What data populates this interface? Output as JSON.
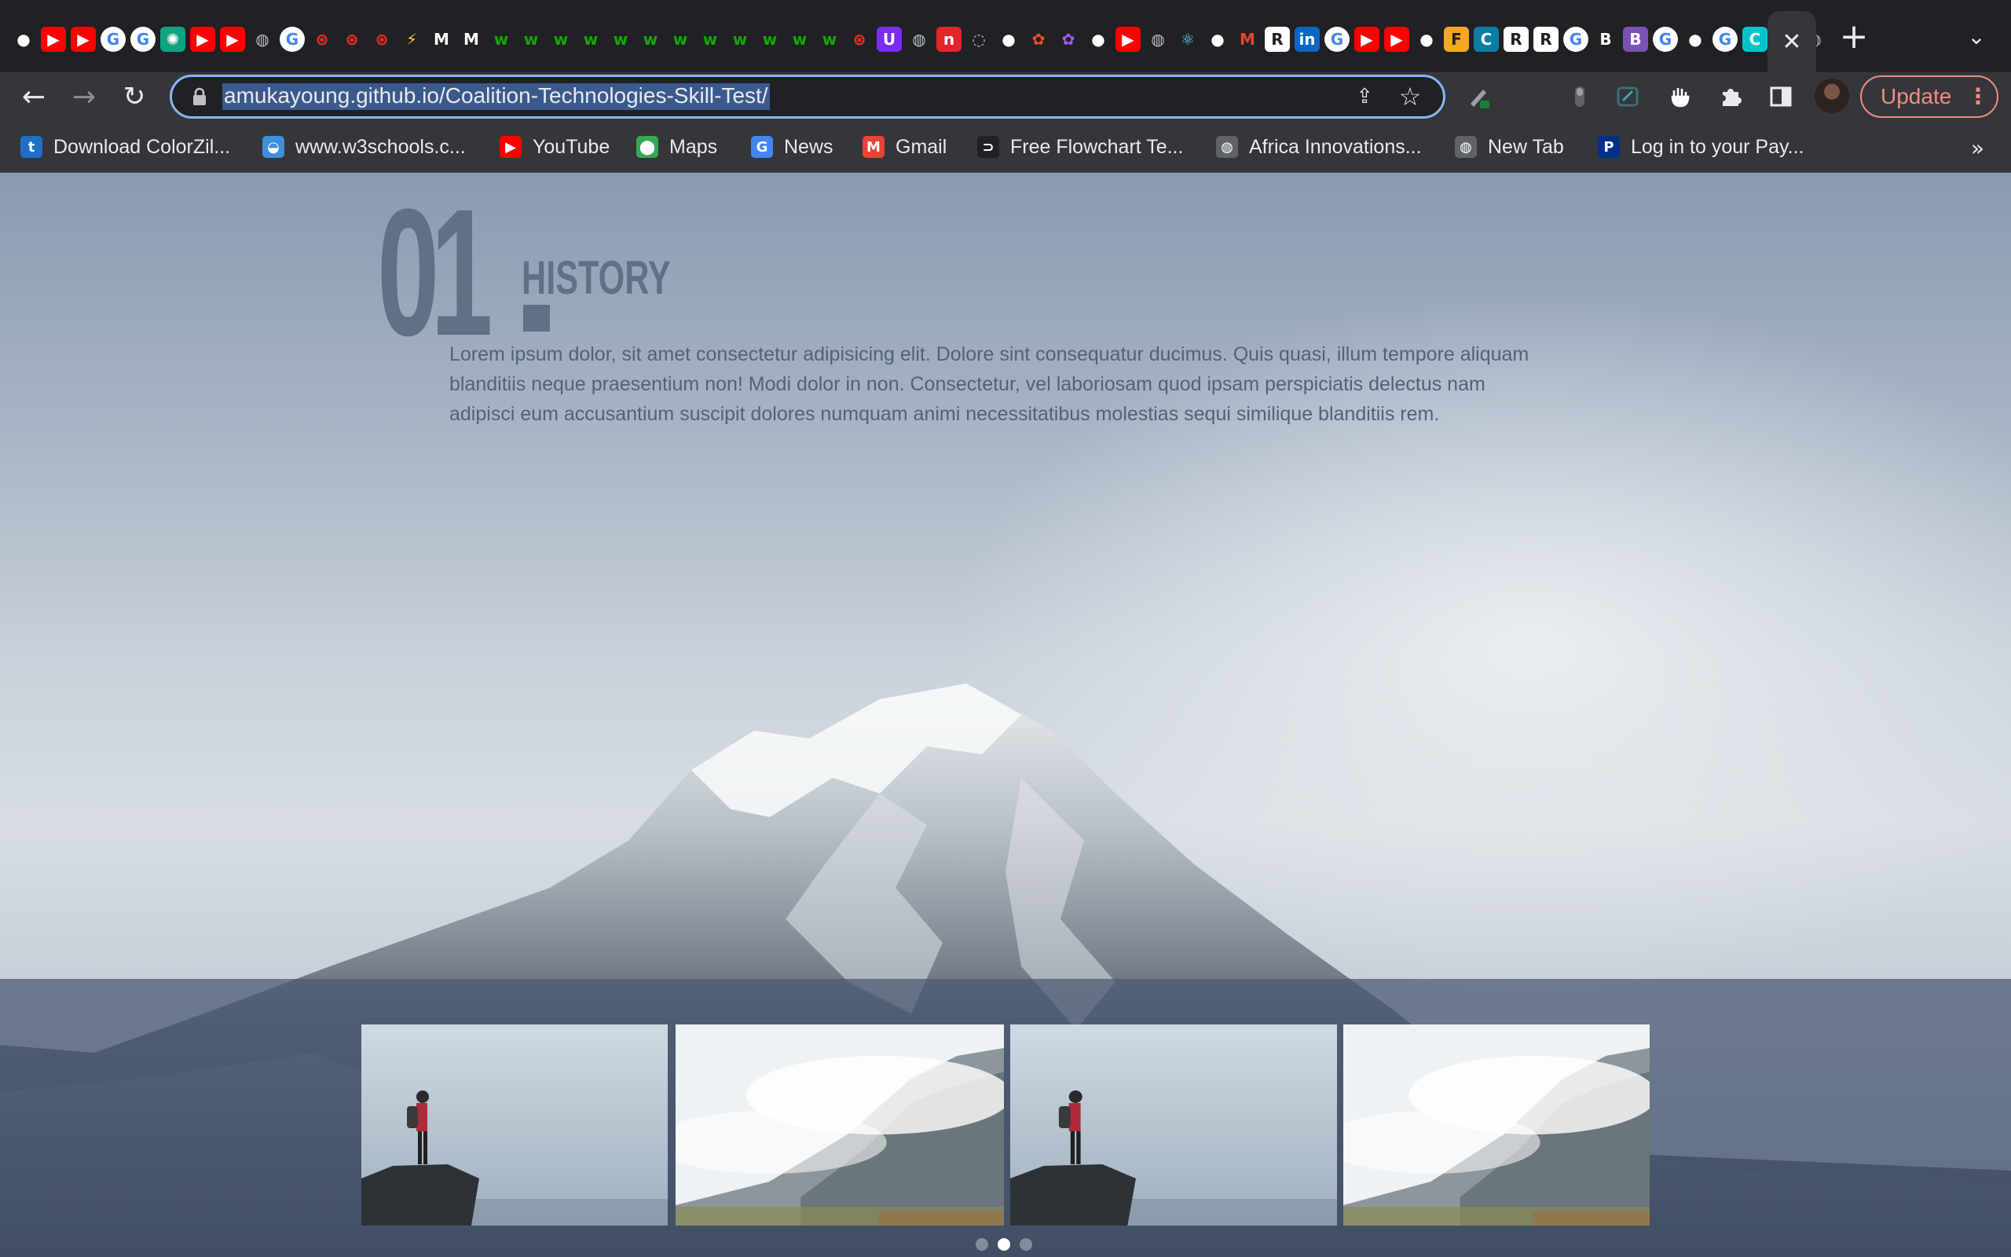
{
  "browser": {
    "tab_favicons": [
      {
        "icon": "github-icon",
        "glyph": "●",
        "color": "#ffffff",
        "bg": "#202124"
      },
      {
        "icon": "youtube-icon",
        "glyph": "▶",
        "color": "#ffffff",
        "bg": "#ff0000"
      },
      {
        "icon": "youtube-icon",
        "glyph": "▶",
        "color": "#ffffff",
        "bg": "#ff0000"
      },
      {
        "icon": "google-icon",
        "glyph": "G",
        "color": "#4285f4",
        "bg": "#ffffff"
      },
      {
        "icon": "google-icon",
        "glyph": "G",
        "color": "#4285f4",
        "bg": "#ffffff"
      },
      {
        "icon": "chatgpt-icon",
        "glyph": "✺",
        "color": "#ffffff",
        "bg": "#10a37f"
      },
      {
        "icon": "youtube-icon",
        "glyph": "▶",
        "color": "#ffffff",
        "bg": "#ff0000"
      },
      {
        "icon": "youtube-icon",
        "glyph": "▶",
        "color": "#ffffff",
        "bg": "#ff0000"
      },
      {
        "icon": "globe-icon",
        "glyph": "◍",
        "color": "#bdc1c6",
        "bg": "#202124"
      },
      {
        "icon": "google-icon",
        "glyph": "G",
        "color": "#4285f4",
        "bg": "#ffffff"
      },
      {
        "icon": "laravel-icon",
        "glyph": "⊛",
        "color": "#ff2d20",
        "bg": "#202124"
      },
      {
        "icon": "laravel-icon",
        "glyph": "⊛",
        "color": "#ff2d20",
        "bg": "#202124"
      },
      {
        "icon": "laravel-icon",
        "glyph": "⊛",
        "color": "#ff2d20",
        "bg": "#202124"
      },
      {
        "icon": "vite-icon",
        "glyph": "⚡",
        "color": "#ffd028",
        "bg": "#202124"
      },
      {
        "icon": "medium-icon",
        "glyph": "M",
        "color": "#ffffff",
        "bg": "#202124"
      },
      {
        "icon": "medium-icon",
        "glyph": "M",
        "color": "#ffffff",
        "bg": "#202124"
      },
      {
        "icon": "upwork-icon",
        "glyph": "w",
        "color": "#14a800",
        "bg": "#202124"
      },
      {
        "icon": "upwork-icon",
        "glyph": "w",
        "color": "#14a800",
        "bg": "#202124"
      },
      {
        "icon": "upwork-icon",
        "glyph": "w",
        "color": "#14a800",
        "bg": "#202124"
      },
      {
        "icon": "upwork-icon",
        "glyph": "w",
        "color": "#14a800",
        "bg": "#202124"
      },
      {
        "icon": "upwork-icon",
        "glyph": "w",
        "color": "#14a800",
        "bg": "#202124"
      },
      {
        "icon": "upwork-icon",
        "glyph": "w",
        "color": "#14a800",
        "bg": "#202124"
      },
      {
        "icon": "upwork-icon",
        "glyph": "w",
        "color": "#14a800",
        "bg": "#202124"
      },
      {
        "icon": "upwork-icon",
        "glyph": "w",
        "color": "#14a800",
        "bg": "#202124"
      },
      {
        "icon": "upwork-icon",
        "glyph": "w",
        "color": "#14a800",
        "bg": "#202124"
      },
      {
        "icon": "upwork-icon",
        "glyph": "w",
        "color": "#14a800",
        "bg": "#202124"
      },
      {
        "icon": "upwork-icon",
        "glyph": "w",
        "color": "#14a800",
        "bg": "#202124"
      },
      {
        "icon": "upwork-icon",
        "glyph": "w",
        "color": "#14a800",
        "bg": "#202124"
      },
      {
        "icon": "laravel-icon",
        "glyph": "⊛",
        "color": "#ff2d20",
        "bg": "#202124"
      },
      {
        "icon": "shield-icon",
        "glyph": "U",
        "color": "#ffffff",
        "bg": "#7b2cf5"
      },
      {
        "icon": "globe-icon",
        "glyph": "◍",
        "color": "#bdc1c6",
        "bg": "#202124"
      },
      {
        "icon": "n-icon",
        "glyph": "n",
        "color": "#ffffff",
        "bg": "#e0262b"
      },
      {
        "icon": "loading-icon",
        "glyph": "◌",
        "color": "#bdc1c6",
        "bg": "#202124"
      },
      {
        "icon": "github-icon",
        "glyph": "●",
        "color": "#ffffff",
        "bg": "#202124"
      },
      {
        "icon": "figma-icon",
        "glyph": "✿",
        "color": "#f24e1e",
        "bg": "#202124"
      },
      {
        "icon": "figma-icon",
        "glyph": "✿",
        "color": "#a259ff",
        "bg": "#202124"
      },
      {
        "icon": "github-icon",
        "glyph": "●",
        "color": "#ffffff",
        "bg": "#202124"
      },
      {
        "icon": "youtube-icon",
        "glyph": "▶",
        "color": "#ffffff",
        "bg": "#ff0000"
      },
      {
        "icon": "globe-icon",
        "glyph": "◍",
        "color": "#bdc1c6",
        "bg": "#202124"
      },
      {
        "icon": "react-icon",
        "glyph": "⚛",
        "color": "#61dafb",
        "bg": "#202124"
      },
      {
        "icon": "github-icon",
        "glyph": "●",
        "color": "#ffffff",
        "bg": "#202124"
      },
      {
        "icon": "gmail-icon",
        "glyph": "M",
        "color": "#ea4335",
        "bg": "#202124"
      },
      {
        "icon": "r-icon",
        "glyph": "R",
        "color": "#202124",
        "bg": "#ffffff"
      },
      {
        "icon": "linkedin-icon",
        "glyph": "in",
        "color": "#ffffff",
        "bg": "#0a66c2"
      },
      {
        "icon": "google-icon",
        "glyph": "G",
        "color": "#4285f4",
        "bg": "#ffffff"
      },
      {
        "icon": "youtube-icon",
        "glyph": "▶",
        "color": "#ffffff",
        "bg": "#ff0000"
      },
      {
        "icon": "youtube-icon",
        "glyph": "▶",
        "color": "#ffffff",
        "bg": "#ff0000"
      },
      {
        "icon": "github-icon",
        "glyph": "●",
        "color": "#ffffff",
        "bg": "#202124"
      },
      {
        "icon": "f-icon",
        "glyph": "F",
        "color": "#202124",
        "bg": "#f5a623"
      },
      {
        "icon": "c-icon",
        "glyph": "C",
        "color": "#ffffff",
        "bg": "#0a7ea4"
      },
      {
        "icon": "r-icon",
        "glyph": "R",
        "color": "#202124",
        "bg": "#ffffff"
      },
      {
        "icon": "r-icon",
        "glyph": "R",
        "color": "#202124",
        "bg": "#ffffff"
      },
      {
        "icon": "google-icon",
        "glyph": "G",
        "color": "#4285f4",
        "bg": "#ffffff"
      },
      {
        "icon": "b-icon",
        "glyph": "B",
        "color": "#ffffff",
        "bg": "#202124"
      },
      {
        "icon": "bootstrap-icon",
        "glyph": "B",
        "color": "#ffffff",
        "bg": "#7952b3"
      },
      {
        "icon": "google-icon",
        "glyph": "G",
        "color": "#4285f4",
        "bg": "#ffffff"
      },
      {
        "icon": "github-icon",
        "glyph": "●",
        "color": "#ffffff",
        "bg": "#202124"
      },
      {
        "icon": "google-icon",
        "glyph": "G",
        "color": "#4285f4",
        "bg": "#ffffff"
      },
      {
        "icon": "canva-icon",
        "glyph": "C",
        "color": "#ffffff",
        "bg": "#00c4cc"
      },
      {
        "icon": "github-icon",
        "glyph": "●",
        "color": "#ffffff",
        "bg": "#202124"
      },
      {
        "icon": "globe-icon",
        "glyph": "◍",
        "color": "#bdc1c6",
        "bg": "#202124"
      }
    ],
    "active_tab_close": "✕",
    "new_tab_glyph": "+",
    "tab_search_glyph": "⌄",
    "back_glyph": "←",
    "forward_glyph": "→",
    "reload_glyph": "↻",
    "url": "amukayoung.github.io/Coalition-Technologies-Skill-Test/",
    "share_glyph": "⇪",
    "star_glyph": "☆",
    "update_label": "Update",
    "menu_glyph": "⋮",
    "accent_color": "#8ab4f8",
    "update_color": "#f28b82"
  },
  "bookmarks": [
    {
      "label": "Download ColorZil...",
      "icon": "colorzilla-icon",
      "glyph": "t",
      "bg": "#1f6fc5"
    },
    {
      "label": "www.w3schools.c...",
      "icon": "w3schools-icon",
      "glyph": "◒",
      "bg": "#3c8fdb"
    },
    {
      "label": "YouTube",
      "icon": "youtube-icon",
      "glyph": "▶",
      "bg": "#ff0000"
    },
    {
      "label": "Maps",
      "icon": "maps-pin-icon",
      "glyph": "⬤",
      "bg": "#34a853"
    },
    {
      "label": "News",
      "icon": "google-news-icon",
      "glyph": "G",
      "bg": "#4285f4"
    },
    {
      "label": "Gmail",
      "icon": "gmail-icon",
      "glyph": "M",
      "bg": "#ea4335"
    },
    {
      "label": "Free Flowchart Te...",
      "icon": "flowchart-icon",
      "glyph": "⊃",
      "bg": "#202124"
    },
    {
      "label": "Africa Innovations...",
      "icon": "globe-icon",
      "glyph": "◍",
      "bg": "#5f6368"
    },
    {
      "label": "New Tab",
      "icon": "globe-icon",
      "glyph": "◍",
      "bg": "#5f6368"
    },
    {
      "label": "Log in to your Pay...",
      "icon": "paypal-icon",
      "glyph": "P",
      "bg": "#003087"
    }
  ],
  "bookmarks_more": "»",
  "page": {
    "history": {
      "number": "01",
      "title": "HISTORY",
      "text": "Lorem ipsum dolor, sit amet consectetur adipisicing elit. Dolore sint consequatur ducimus. Quis quasi, illum tempore aliquam blanditiis neque praesentium non! Modi dolor in non. Consectetur, vel laboriosam quod ipsam perspiciatis delectus nam adipisci eum accusantium suscipit dolores numquam animi necessitatibus molestias sequi similique blanditiis rem."
    },
    "gallery": [
      {
        "subject": "hiker on rock"
      },
      {
        "subject": "misty mountain"
      },
      {
        "subject": "hiker on rock"
      },
      {
        "subject": "misty mountain"
      }
    ],
    "carousel": {
      "count": 3,
      "active_index": 1
    },
    "heading_color": "#5f7088",
    "band_color": "#4a5975"
  }
}
